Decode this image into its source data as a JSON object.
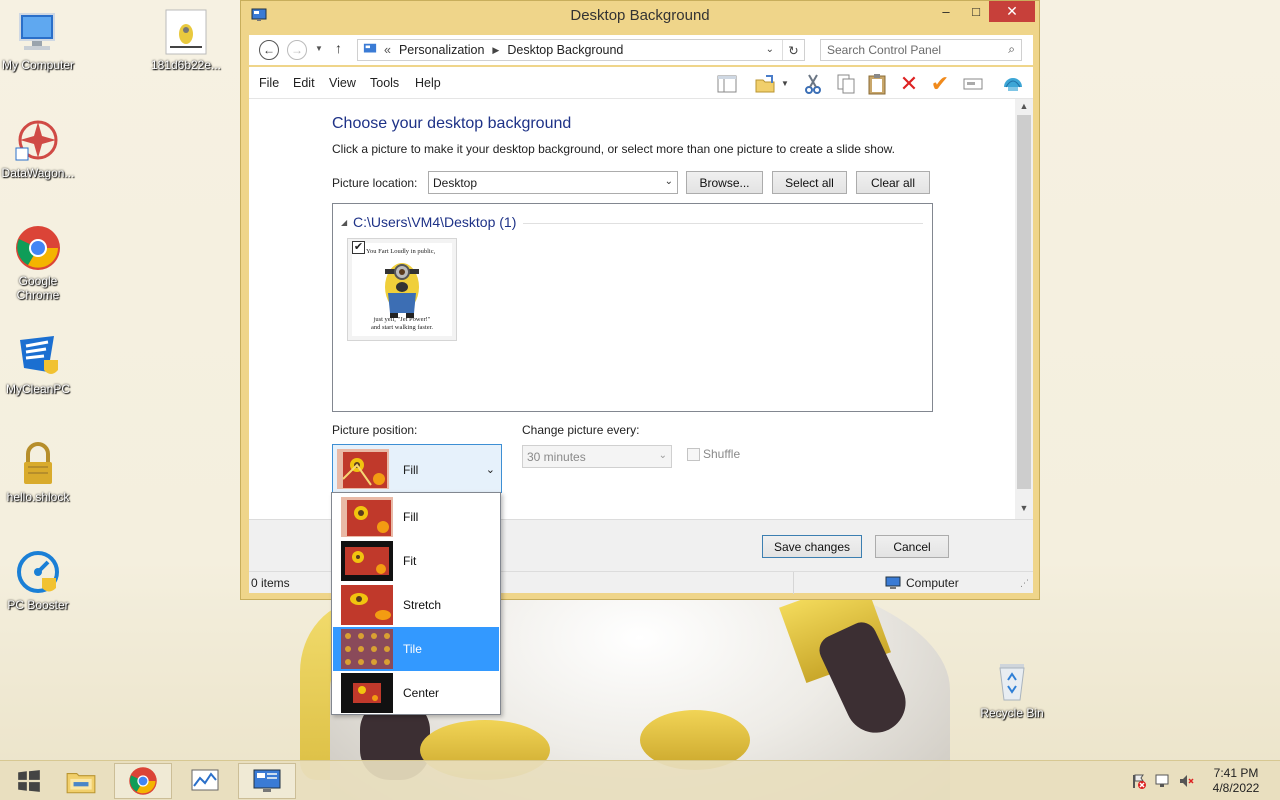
{
  "desktop": {
    "icons": [
      {
        "label": "My Computer",
        "icon": "computer-icon"
      },
      {
        "label": "181d6b22e...",
        "icon": "image-file-icon"
      },
      {
        "label": "DataWagon...",
        "icon": "datawagon-icon"
      },
      {
        "label": "Google Chrome",
        "icon": "chrome-icon"
      },
      {
        "label": "MyCleanPC",
        "icon": "mycleanpc-icon"
      },
      {
        "label": "hello.shlock",
        "icon": "lock-icon"
      },
      {
        "label": "PC Booster",
        "icon": "pc-booster-icon"
      },
      {
        "label": "Recycle Bin",
        "icon": "recycle-bin-icon"
      }
    ]
  },
  "window": {
    "title": "Desktop Background",
    "address": {
      "root_chevron": "«",
      "crumbs": [
        "Personalization",
        "Desktop Background"
      ]
    },
    "search_placeholder": "Search Control Panel",
    "menu": [
      "File",
      "Edit",
      "View",
      "Tools",
      "Help"
    ],
    "heading": "Choose your desktop background",
    "description": "Click a picture to make it your desktop background, or select more than one picture to create a slide show.",
    "picture_location_label": "Picture location:",
    "picture_location_value": "Desktop",
    "browse_label": "Browse...",
    "select_all_label": "Select all",
    "clear_all_label": "Clear all",
    "folder_header": "C:\\Users\\VM4\\Desktop (1)",
    "thumbnail": {
      "top_text": "You Fart Loudly in public,",
      "bottom_text_1": "just yell, \"Jet Power!\"",
      "bottom_text_2": "and start walking faster.",
      "checked": true
    },
    "picture_position_label": "Picture position:",
    "picture_position_value": "Fill",
    "change_every_label": "Change picture every:",
    "change_every_value": "30 minutes",
    "shuffle_label": "Shuffle",
    "save_label": "Save changes",
    "cancel_label": "Cancel",
    "status_items": "0 items",
    "status_location": "Computer"
  },
  "dropdown": {
    "options": [
      "Fill",
      "Fit",
      "Stretch",
      "Tile",
      "Center"
    ],
    "selected_index": 3
  },
  "taskbar": {
    "apps": [
      "start-button",
      "file-explorer-icon",
      "chrome-icon",
      "performance-monitor-icon",
      "control-panel-icon"
    ],
    "time": "7:41 PM",
    "date": "4/8/2022"
  },
  "colors": {
    "window_frame": "#efd58a",
    "heading": "#1e3287",
    "selection": "#3399ff",
    "close_button": "#c7403a"
  }
}
